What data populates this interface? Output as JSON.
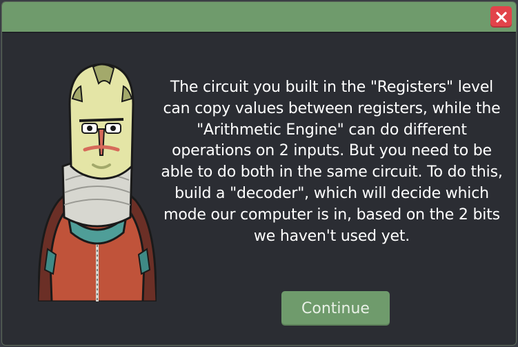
{
  "dialog": {
    "message": "The circuit you built in the \"Registers\" level can copy values between registers, while the \"Arithmetic Engine\" can do different operations on 2 inputs. But you need to be able to do both in the same circuit. To do this, build a \"decoder\", which will decide which mode our computer is in, based on the 2 bits we haven't used yet.",
    "continue_label": "Continue",
    "close_icon": "close-icon",
    "character": "alien-character-portrait"
  },
  "colors": {
    "titlebar": "#6f9b6c",
    "background": "#2b2d33",
    "close_button": "#e2434a",
    "continue_button": "#6f9b6c"
  }
}
